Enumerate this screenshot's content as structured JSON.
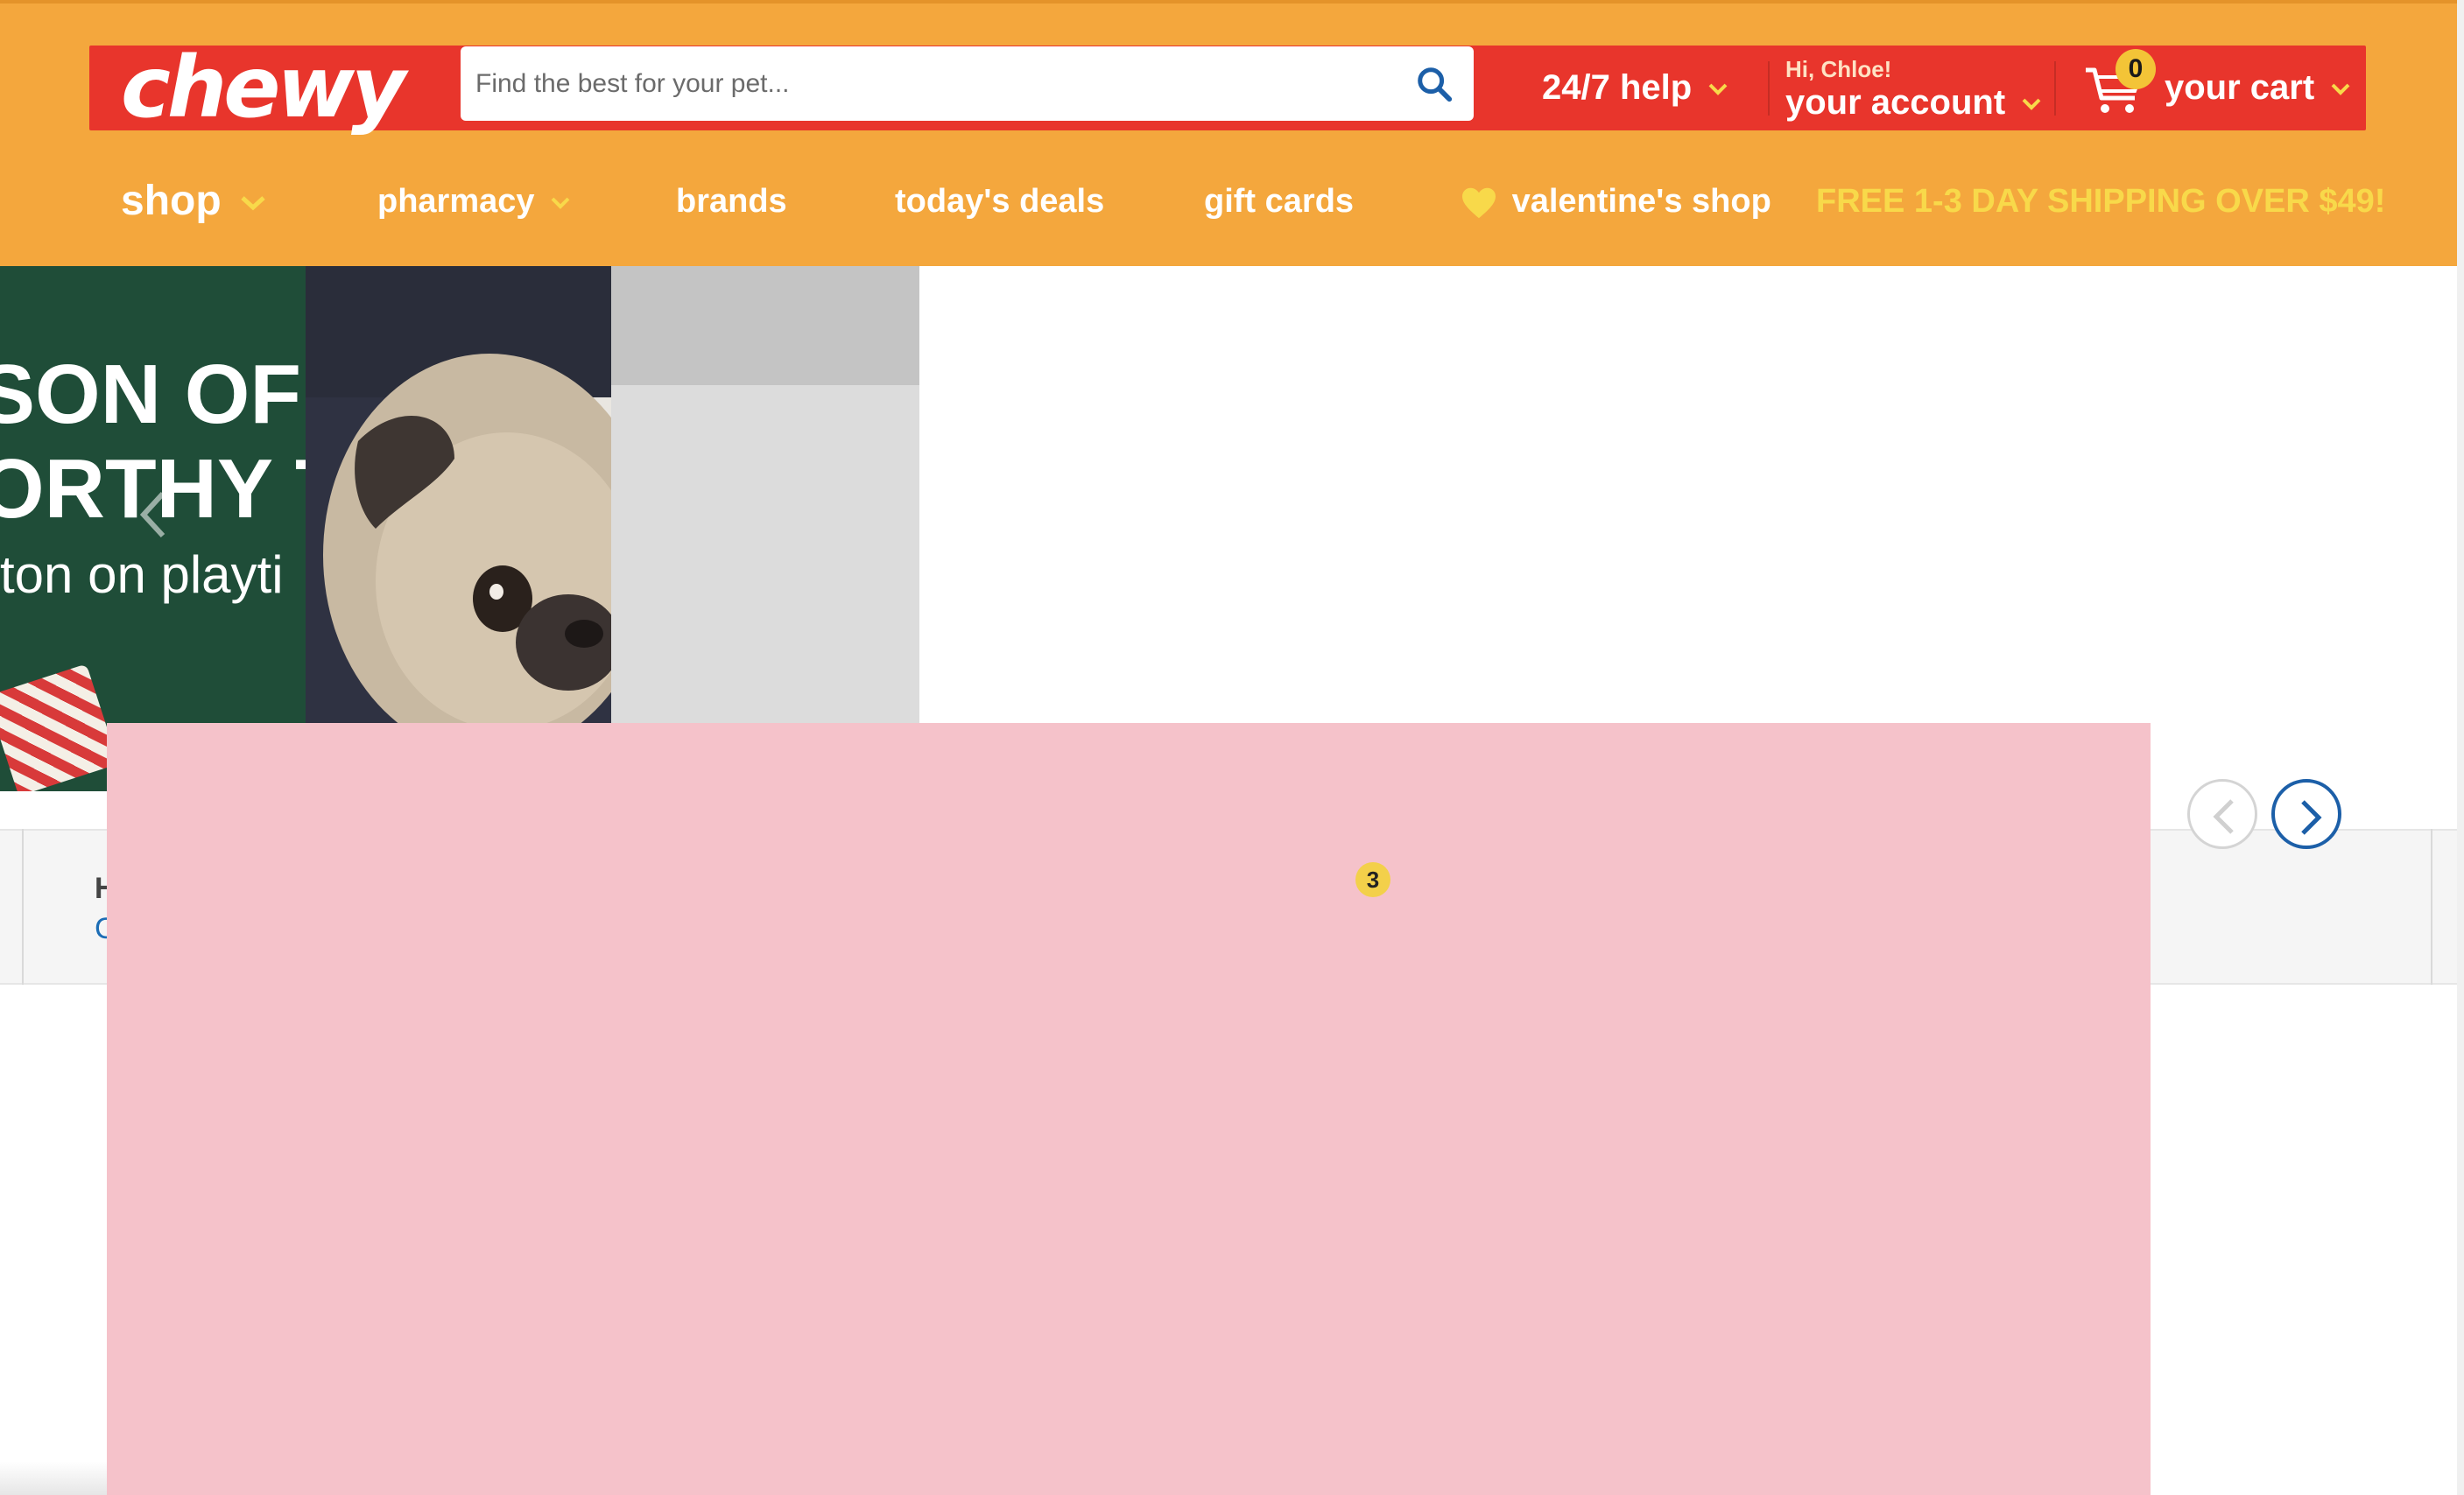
{
  "header": {
    "logo_text": "chewy",
    "search_placeholder": "Find the best for your pet...",
    "help_label": "24/7 help",
    "account_greeting": "Hi, Chloe!",
    "account_label": "your account",
    "cart_count": "0",
    "cart_label": "your cart",
    "colors": {
      "band": "#f4a73d",
      "bar": "#e8352c",
      "shipping_text": "#f8d94a"
    }
  },
  "nav": {
    "shop": "shop",
    "pharmacy": "pharmacy",
    "brands": "brands",
    "todays_deals": "today's deals",
    "gift_cards": "gift cards",
    "valentines_shop": "valentine's shop",
    "shipping_promo": "FREE 1-3 DAY SHIPPING OVER $49!"
  },
  "banner": {
    "line1": "SON OF",
    "line2": "ORTHY T",
    "line3": "ton on playti"
  },
  "strip": {
    "heading_fragment": "H",
    "link_fragment": "C"
  },
  "overlay": {
    "badge": "3",
    "color": "#f5c2ca"
  }
}
